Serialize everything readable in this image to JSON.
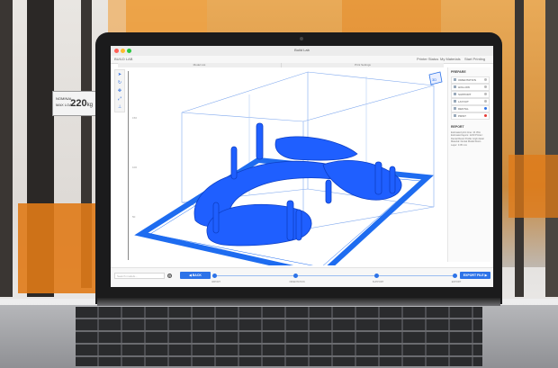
{
  "background": {
    "scale_tag": {
      "label": "NOMINAL MAX LOAD",
      "value": "220",
      "unit": "kg"
    }
  },
  "window": {
    "title": "Build Lab",
    "traffic_lights": [
      "#ff5f57",
      "#febc2e",
      "#28c840"
    ],
    "menu_left": "BUILD LAB",
    "menu_right": [
      "Printer Status",
      "My Materials",
      "Start Printing"
    ]
  },
  "tabs": [
    "Model List",
    "Print Settings"
  ],
  "tools": [
    "arrow-icon",
    "rotate-icon",
    "move-icon",
    "scale-icon",
    "support-icon"
  ],
  "ruler": [
    "150",
    "100",
    "50"
  ],
  "viewport": {
    "dental_model_color": "#1f5fff",
    "platform_color": "#1e6cf0"
  },
  "panel": {
    "title": "PREPARE",
    "rows": [
      {
        "label": "ORIENTATION",
        "dot": "#bbbbbb"
      },
      {
        "label": "HOLLOW",
        "dot": "#bbbbbb"
      },
      {
        "label": "SUPPORT",
        "dot": "#bbbbbb"
      },
      {
        "label": "LAYOUT",
        "dot": "#bbbbbb"
      },
      {
        "label": "DENTAL",
        "dot": "#2d73e8"
      },
      {
        "label": "PRINT",
        "dot": "#e53935"
      }
    ],
    "section_title": "REPORT",
    "text": "Estimated print time: 1h 45m Estimated layers: 1240  Printer: Dental Resin  Profile: High detail  Material: Dental Model Resin  Layer: 0.05 mm"
  },
  "bottombar": {
    "search_placeholder": "Search models...",
    "back_label": "◀ BACK",
    "next_label": "EXPORT FILE ▶",
    "steps": [
      "IMPORT",
      "ORIENTATION",
      "SUPPORT",
      "EXPORT"
    ]
  }
}
